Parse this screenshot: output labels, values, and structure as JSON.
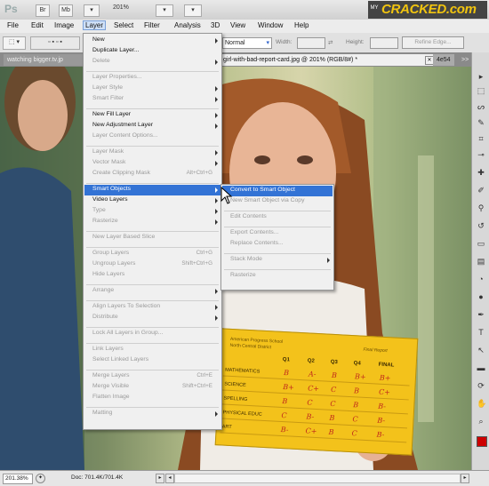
{
  "app": {
    "logo": "Ps",
    "btn_br": "Br",
    "btn_mb": "Mb",
    "zoom": "201%",
    "brand_prefix": "MY",
    "brand_name": "CRACKED.com"
  },
  "menubar": [
    "File",
    "Edit",
    "Image",
    "Layer",
    "Select",
    "Filter",
    "Analysis",
    "3D",
    "View",
    "Window",
    "Help"
  ],
  "options": {
    "mode": "Normal",
    "width_label": "Width:",
    "height_label": "Height:",
    "refine_button": "Refine Edge..."
  },
  "tabs": {
    "left": "watching bigger.tv.jp",
    "active": "girl-with-bad-report-card.jpg @ 201% (RGB/8#) *",
    "next": "4e54",
    "overflow": ">>"
  },
  "layer_menu": [
    {
      "label": "New",
      "sub": true
    },
    {
      "label": "Duplicate Layer..."
    },
    {
      "label": "Delete",
      "dis": true,
      "sub": true
    },
    {
      "sep": true
    },
    {
      "label": "Layer Properties...",
      "dis": true
    },
    {
      "label": "Layer Style",
      "dis": true,
      "sub": true
    },
    {
      "label": "Smart Filter",
      "dis": true,
      "sub": true
    },
    {
      "sep": true
    },
    {
      "label": "New Fill Layer",
      "sub": true
    },
    {
      "label": "New Adjustment Layer",
      "sub": true
    },
    {
      "label": "Layer Content Options...",
      "dis": true
    },
    {
      "sep": true
    },
    {
      "label": "Layer Mask",
      "dis": true,
      "sub": true
    },
    {
      "label": "Vector Mask",
      "dis": true,
      "sub": true
    },
    {
      "label": "Create Clipping Mask",
      "dis": true,
      "short": "Alt+Ctrl+G"
    },
    {
      "sep": true
    },
    {
      "label": "Smart Objects",
      "sub": true,
      "hl": true
    },
    {
      "label": "Video Layers",
      "sub": true
    },
    {
      "label": "Type",
      "dis": true,
      "sub": true
    },
    {
      "label": "Rasterize",
      "dis": true,
      "sub": true
    },
    {
      "sep": true
    },
    {
      "label": "New Layer Based Slice",
      "dis": true
    },
    {
      "sep": true
    },
    {
      "label": "Group Layers",
      "dis": true,
      "short": "Ctrl+G"
    },
    {
      "label": "Ungroup Layers",
      "dis": true,
      "short": "Shift+Ctrl+G"
    },
    {
      "label": "Hide Layers",
      "dis": true
    },
    {
      "sep": true
    },
    {
      "label": "Arrange",
      "dis": true,
      "sub": true
    },
    {
      "sep": true
    },
    {
      "label": "Align Layers To Selection",
      "dis": true,
      "sub": true
    },
    {
      "label": "Distribute",
      "dis": true,
      "sub": true
    },
    {
      "sep": true
    },
    {
      "label": "Lock All Layers in Group...",
      "dis": true
    },
    {
      "sep": true
    },
    {
      "label": "Link Layers",
      "dis": true
    },
    {
      "label": "Select Linked Layers",
      "dis": true
    },
    {
      "sep": true
    },
    {
      "label": "Merge Layers",
      "dis": true,
      "short": "Ctrl+E"
    },
    {
      "label": "Merge Visible",
      "dis": true,
      "short": "Shift+Ctrl+E"
    },
    {
      "label": "Flatten Image",
      "dis": true
    },
    {
      "sep": true
    },
    {
      "label": "Matting",
      "dis": true,
      "sub": true
    }
  ],
  "smart_menu": [
    {
      "label": "Convert to Smart Object",
      "hl": true
    },
    {
      "label": "New Smart Object via Copy",
      "dis": true
    },
    {
      "sep": true
    },
    {
      "label": "Edit Contents",
      "dis": true
    },
    {
      "sep": true
    },
    {
      "label": "Export Contents...",
      "dis": true
    },
    {
      "label": "Replace Contents...",
      "dis": true
    },
    {
      "sep": true
    },
    {
      "label": "Stack Mode",
      "dis": true,
      "sub": true
    },
    {
      "sep": true
    },
    {
      "label": "Rasterize",
      "dis": true
    }
  ],
  "report_card": {
    "school": "American Progress School",
    "district": "North Central District",
    "title": "Final Report",
    "headers": [
      "Q1",
      "Q2",
      "Q3",
      "Q4",
      "FINAL"
    ],
    "rows": [
      {
        "subject": "MATHEMATICS",
        "grades": [
          "B",
          "A-",
          "B",
          "B+",
          "B+"
        ]
      },
      {
        "subject": "SCIENCE",
        "grades": [
          "B+",
          "C+",
          "C",
          "B",
          "C+"
        ]
      },
      {
        "subject": "SPELLING",
        "grades": [
          "B",
          "C",
          "C",
          "B",
          "B-"
        ]
      },
      {
        "subject": "PHYSICAL EDUC",
        "grades": [
          "C",
          "B-",
          "B",
          "C",
          "B-"
        ]
      },
      {
        "subject": "ART",
        "grades": [
          "B-",
          "C+",
          "B",
          "C",
          "B-"
        ]
      }
    ]
  },
  "status": {
    "zoom": "201.38%",
    "doc": "Doc: 701.4K/701.4K"
  },
  "colors": {
    "highlight": "#3373d5",
    "card": "#f3c21b",
    "brand": "#f1c40f"
  }
}
